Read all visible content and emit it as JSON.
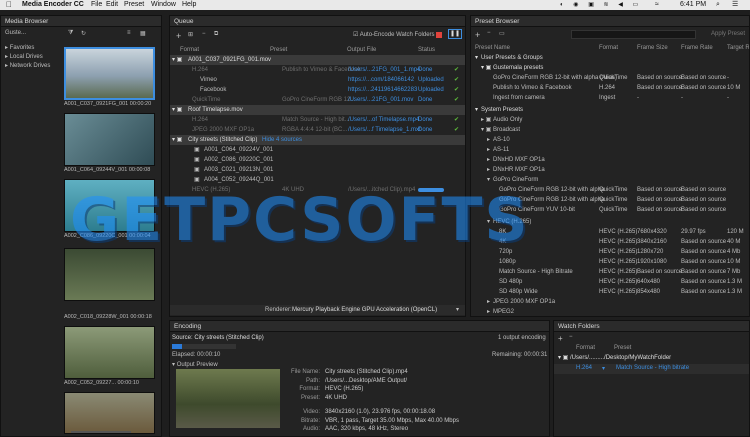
{
  "menubar": {
    "app_name": "Media Encoder CC",
    "menus": [
      "File",
      "Edit",
      "Preset",
      "Window",
      "Help"
    ],
    "clock": "6:41 PM"
  },
  "media_browser": {
    "title": "Media Browser",
    "location": "Guste...",
    "tree": [
      "Favorites",
      "Local Drives",
      "Network Drives"
    ],
    "thumbs": [
      {
        "label": "A001_C037_0921FG_001",
        "duration": "00:00:20",
        "color": "#8da0b0"
      },
      {
        "label": "A001_C064_09244V_001",
        "duration": "00:00:08",
        "color": "#4c6f7c"
      },
      {
        "label": "A002_C086_09220C_001",
        "duration": "00:00:04",
        "color": "#3f8ea0"
      },
      {
        "label": "A002_C018_09228W_001",
        "duration": "00:00:18",
        "color": "#4d5a3e"
      },
      {
        "label": "A002_C052_09227...",
        "duration": "00:00:10",
        "color": "#6b7a5a"
      },
      {
        "label": "",
        "duration": "",
        "color": "#7e6d4a"
      }
    ]
  },
  "queue": {
    "title": "Queue",
    "auto_encode": "Auto-Encode Watch Folders",
    "headers": {
      "format": "Format",
      "preset": "Preset",
      "output": "Output File",
      "status": "Status"
    },
    "items": [
      {
        "name": "A001_C037_0921FG_001.mov",
        "sub": [
          {
            "format": "H.264",
            "preset": "Publish to Vimeo & Facebook",
            "output": "/Users/...21FG_001_1.mp4",
            "status": "Done"
          },
          {
            "format": "Vimeo",
            "preset": "",
            "output": "https://...com/184066142",
            "status": "Uploaded"
          },
          {
            "format": "Facebook",
            "preset": "",
            "output": "https://...24119614662283",
            "status": "Uploaded"
          },
          {
            "format": "QuickTime",
            "preset": "GoPro CineForm RGB 12...",
            "output": "/Users/...21FG_001.mov",
            "status": "Done"
          }
        ]
      },
      {
        "name": "Roof Timelapse.mov",
        "sub": [
          {
            "format": "H.264",
            "preset": "Match Source - High bit...",
            "output": "/Users/...of Timelapse.mp4",
            "status": "Done"
          },
          {
            "format": "JPEG 2000 MXF OP1a",
            "preset": "RGBA 4:4:4 12-bit (BC...",
            "output": "/Users/...f Timelapse_1.mxf",
            "status": "Done"
          }
        ]
      }
    ],
    "stitched": {
      "name": "City streets (Stitched Clip)",
      "hide": "Hide 4 sources"
    },
    "sources": [
      "A001_C064_09224V_001",
      "A002_C086_09220C_001",
      "A003_C021_09213N_001",
      "A004_C052_09244Q_001"
    ],
    "encoding_row": {
      "format": "HEVC (H.265)",
      "preset": "4K UHD",
      "output": "/Users/...itched Clip).mp4"
    },
    "renderer_label": "Renderer:",
    "renderer": "Mercury Playback Engine GPU Acceleration (OpenCL)"
  },
  "preset_browser": {
    "title": "Preset Browser",
    "apply": "Apply Preset",
    "headers": {
      "name": "Preset Name",
      "format": "Format",
      "frame_size": "Frame Size",
      "frame_rate": "Frame Rate",
      "target": "Target R"
    },
    "user_group": "User Presets & Groups",
    "user_sub": "Gustemala presets",
    "user_rows": [
      {
        "name": "GoPro CineForm RGB 12-bit with alpha (Alias)",
        "format": "QuickTime",
        "size": "Based on source",
        "rate": "Based on source",
        "target": "-"
      },
      {
        "name": "Publish to Vimeo & Facebook",
        "format": "H.264",
        "size": "Based on source",
        "rate": "Based on source",
        "target": "10 M"
      },
      {
        "name": "Ingest from camera",
        "format": "Ingest",
        "size": "-",
        "rate": "-",
        "target": "-"
      }
    ],
    "system_group": "System Presets",
    "system_rows": [
      "Audio Only",
      "Broadcast",
      "AS-10",
      "AS-11",
      "DNxHD MXF OP1a",
      "DNxHR MXF OP1a",
      "GoPro CineForm"
    ],
    "cineform_rows": [
      {
        "name": "GoPro CineForm RGB 12-bit with alpha",
        "format": "QuickTime",
        "size": "Based on source",
        "rate": "Based on source"
      },
      {
        "name": "GoPro CineForm RGB 12-bit with alpha",
        "format": "QuickTime",
        "size": "Based on source",
        "rate": "Based on source"
      },
      {
        "name": "GoPro CineForm YUV 10-bit",
        "format": "QuickTime",
        "size": "Based on source",
        "rate": "Based on source"
      }
    ],
    "hevc_group": "HEVC (H.265)",
    "hevc_rows": [
      {
        "name": "8K",
        "format": "HEVC (H.265)",
        "size": "7680x4320",
        "rate": "29.97 fps",
        "target": "120 M"
      },
      {
        "name": "4K",
        "format": "HEVC (H.265)",
        "size": "3840x2160",
        "rate": "Based on source",
        "target": "40 M"
      },
      {
        "name": "720p",
        "format": "HEVC (H.265)",
        "size": "1280x720",
        "rate": "Based on source",
        "target": "4 Mb"
      },
      {
        "name": "1080p",
        "format": "HEVC (H.265)",
        "size": "1920x1080",
        "rate": "Based on source",
        "target": "10 M"
      },
      {
        "name": "Match Source - High Bitrate",
        "format": "HEVC (H.265)",
        "size": "Based on source",
        "rate": "Based on source",
        "target": "7 Mb"
      },
      {
        "name": "SD 480p",
        "format": "HEVC (H.265)",
        "size": "640x480",
        "rate": "Based on source",
        "target": "1.3 M"
      },
      {
        "name": "SD 480p Wide",
        "format": "HEVC (H.265)",
        "size": "854x480",
        "rate": "Based on source",
        "target": "1.3 M"
      }
    ],
    "tail_rows": [
      "JPEG 2000 MXF OP1a",
      "MPEG2"
    ]
  },
  "encoding": {
    "title": "Encoding",
    "source": "Source: City streets (Stitched Clip)",
    "outputs": "1 output encoding",
    "progress": 0.15,
    "elapsed": "Elapsed: 00:00:10",
    "remaining": "Remaining: 00:00:31",
    "preview_label": "Output Preview",
    "info": [
      {
        "k": "File Name:",
        "v": "City streets (Stitched Clip).mp4"
      },
      {
        "k": "Path:",
        "v": "/Users/...Desktop/AME Output/"
      },
      {
        "k": "Format:",
        "v": "HEVC (H.265)"
      },
      {
        "k": "Preset:",
        "v": "4K UHD"
      },
      {
        "k": "Video:",
        "v": "3840x2160 (1.0), 23.976 fps, 00:00:18.08"
      },
      {
        "k": "Bitrate:",
        "v": "VBR, 1 pass, Target 35.00 Mbps, Max 40.00 Mbps"
      },
      {
        "k": "Audio:",
        "v": "AAC, 320 kbps, 48 kHz, Stereo"
      }
    ]
  },
  "watch_folders": {
    "title": "Watch Folders",
    "headers": {
      "format": "Format",
      "preset": "Preset"
    },
    "folder": "/Users/........./Desktop/MyWatchFolder",
    "row": {
      "format": "H.264",
      "preset": "Match Source - High bitrate"
    }
  },
  "watermark": "GETPCSOFTS"
}
